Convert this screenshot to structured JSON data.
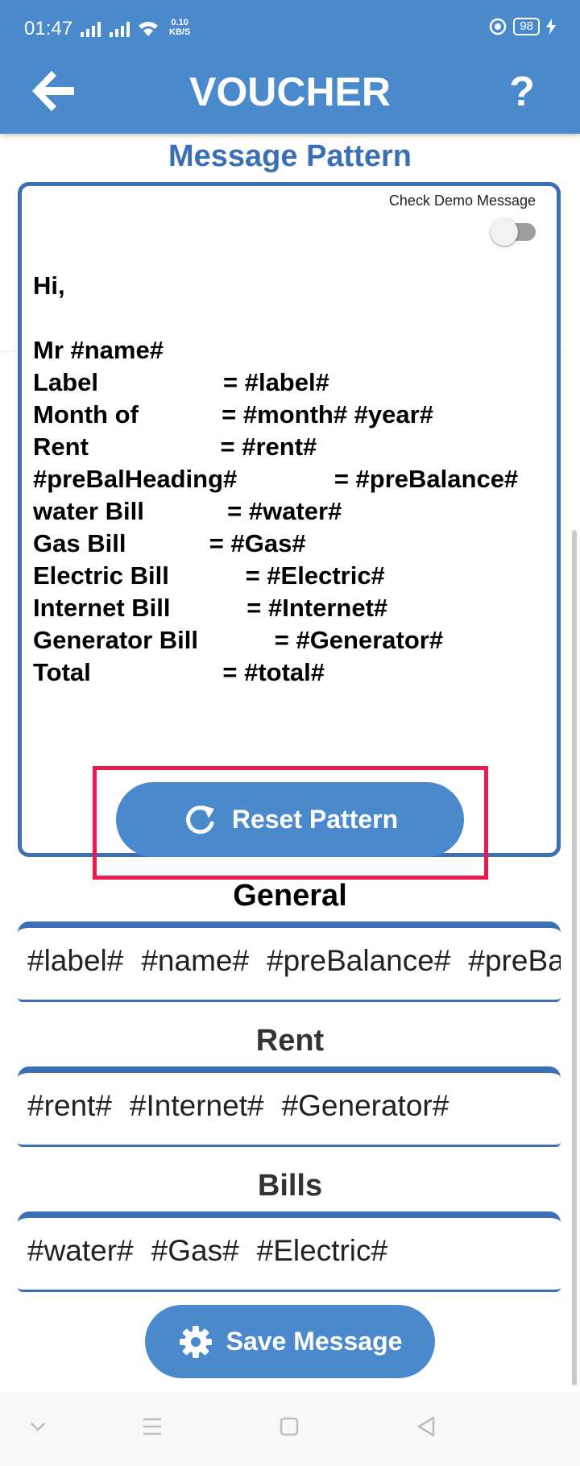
{
  "status_bar": {
    "time": "01:47",
    "speed_value": "0.10",
    "speed_unit": "KB/S",
    "battery": "98"
  },
  "header": {
    "title": "VOUCHER",
    "help_label": "?"
  },
  "message_pattern": {
    "title": "Message Pattern",
    "demo_toggle_label": "Check Demo Message",
    "demo_toggle_on": false,
    "message": "Hi,\n\nMr #name#\nLabel                  = #label#\nMonth of            = #month# #year#\nRent                   = #rent#\n#preBalHeading#              = #preBalance#\nwater Bill            = #water#\nGas Bill            = #Gas#\nElectric Bill           = #Electric#\nInternet Bill           = #Internet#\nGenerator Bill           = #Generator#\nTotal                   = #total#",
    "reset_label": "Reset Pattern"
  },
  "general": {
    "title": "General",
    "tags": [
      "#label#",
      "#name#",
      "#preBalance#",
      "#preBalHeading#"
    ]
  },
  "rent": {
    "title": "Rent",
    "tags": [
      "#rent#",
      "#Internet#",
      "#Generator#"
    ]
  },
  "bills": {
    "title": "Bills",
    "tags": [
      "#water#",
      "#Gas#",
      "#Electric#"
    ]
  },
  "save_label": "Save Message",
  "colors": {
    "primary": "#4a89cc",
    "border": "#3d6fb6",
    "highlight": "#e91b4e"
  }
}
